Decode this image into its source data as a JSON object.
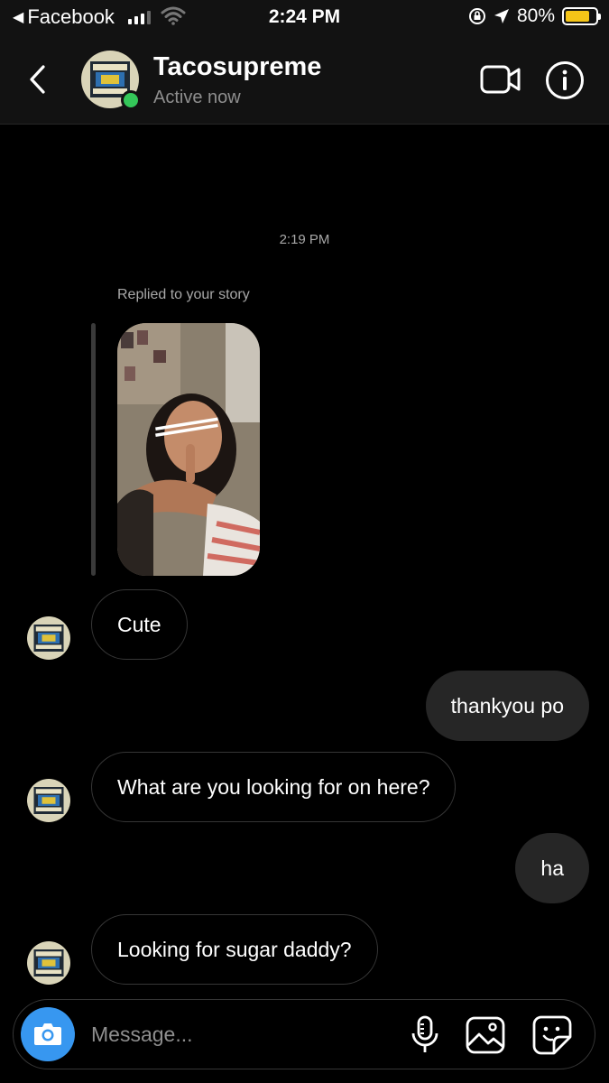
{
  "status_bar": {
    "back_app": "Facebook",
    "time": "2:24 PM",
    "battery": "80%",
    "battery_level": 0.8,
    "icons": [
      "signal-icon",
      "wifi-icon",
      "orientation-lock-icon",
      "location-icon",
      "battery-icon"
    ]
  },
  "header": {
    "name": "Tacosupreme",
    "status": "Active now",
    "icons": [
      "back-chevron-icon",
      "video-call-icon",
      "info-icon"
    ],
    "online_color": "#34c759"
  },
  "chat": {
    "timestamp": "2:19 PM",
    "reply_label": "Replied to your story",
    "messages": [
      {
        "from": "them",
        "text": "Cute"
      },
      {
        "from": "me",
        "text": "thankyou po"
      },
      {
        "from": "them",
        "text": "What are you looking for on here?"
      },
      {
        "from": "me",
        "text": "ha"
      },
      {
        "from": "them",
        "text": "Looking for sugar daddy?"
      }
    ]
  },
  "composer": {
    "placeholder": "Message...",
    "icons": [
      "camera-icon",
      "microphone-icon",
      "gallery-icon",
      "sticker-icon"
    ],
    "camera_color": "#3797f0"
  }
}
